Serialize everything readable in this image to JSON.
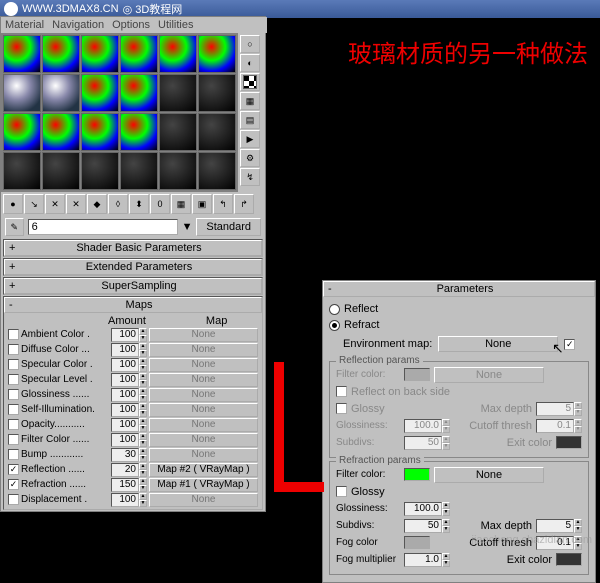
{
  "header": {
    "url": "WWW.3DMAX8.CN",
    "suffix": "◎ 3D教程网"
  },
  "title_cn": "玻璃材质的另一种做法",
  "menubar": [
    "Material",
    "Navigation",
    "Options",
    "Utilities"
  ],
  "name_row": {
    "picker_icon": "eyedropper",
    "value": "6",
    "type_button": "Standard"
  },
  "rollouts": [
    {
      "sign": "+",
      "title": "Shader Basic Parameters"
    },
    {
      "sign": "+",
      "title": "Extended Parameters"
    },
    {
      "sign": "+",
      "title": "SuperSampling"
    },
    {
      "sign": "-",
      "title": "Maps"
    }
  ],
  "maps": {
    "headers": {
      "amount": "Amount",
      "map": "Map"
    },
    "rows": [
      {
        "on": false,
        "label": "Ambient Color .",
        "amount": "100",
        "map": "None"
      },
      {
        "on": false,
        "label": "Diffuse Color ...",
        "amount": "100",
        "map": "None"
      },
      {
        "on": false,
        "label": "Specular Color .",
        "amount": "100",
        "map": "None"
      },
      {
        "on": false,
        "label": "Specular Level .",
        "amount": "100",
        "map": "None"
      },
      {
        "on": false,
        "label": "Glossiness ......",
        "amount": "100",
        "map": "None"
      },
      {
        "on": false,
        "label": "Self-Illumination.",
        "amount": "100",
        "map": "None"
      },
      {
        "on": false,
        "label": "Opacity...........",
        "amount": "100",
        "map": "None"
      },
      {
        "on": false,
        "label": "Filter Color ......",
        "amount": "100",
        "map": "None"
      },
      {
        "on": false,
        "label": "Bump ............",
        "amount": "30",
        "map": "None"
      },
      {
        "on": true,
        "label": "Reflection ......",
        "amount": "20",
        "map": "Map #2 ( VRayMap )"
      },
      {
        "on": true,
        "label": "Refraction ......",
        "amount": "150",
        "map": "Map #1 ( VRayMap )"
      },
      {
        "on": false,
        "label": "Displacement .",
        "amount": "100",
        "map": "None"
      }
    ]
  },
  "params": {
    "header": "Parameters",
    "mode": {
      "reflect": "Reflect",
      "refract": "Refract",
      "selected": "refract"
    },
    "env": {
      "label": "Environment map:",
      "button": "None",
      "checked": true
    },
    "reflection": {
      "title": "Reflection params",
      "filter_label": "Filter color:",
      "filter_map": "None",
      "back_side": "Reflect on back side",
      "glossy": "Glossy",
      "glossiness_label": "Glossiness:",
      "glossiness": "100.0",
      "subdivs_label": "Subdivs:",
      "subdivs": "50",
      "maxdepth_label": "Max depth",
      "maxdepth": "5",
      "cutoff_label": "Cutoff thresh",
      "cutoff": "0.1",
      "exit_label": "Exit color"
    },
    "refraction": {
      "title": "Refraction params",
      "filter_label": "Filter color:",
      "filter_map": "None",
      "glossy": "Glossy",
      "glossiness_label": "Glossiness:",
      "glossiness": "100.0",
      "subdivs_label": "Subdivs:",
      "subdivs": "50",
      "fog_label": "Fog color",
      "fogmult_label": "Fog multiplier",
      "fogmult": "1.0",
      "maxdepth_label": "Max depth",
      "maxdepth": "5",
      "cutoff_label": "Cutoff thresh",
      "cutoff": "0.1",
      "exit_label": "Exit color"
    }
  },
  "watermark": "jiaocheng.chazidian.com"
}
